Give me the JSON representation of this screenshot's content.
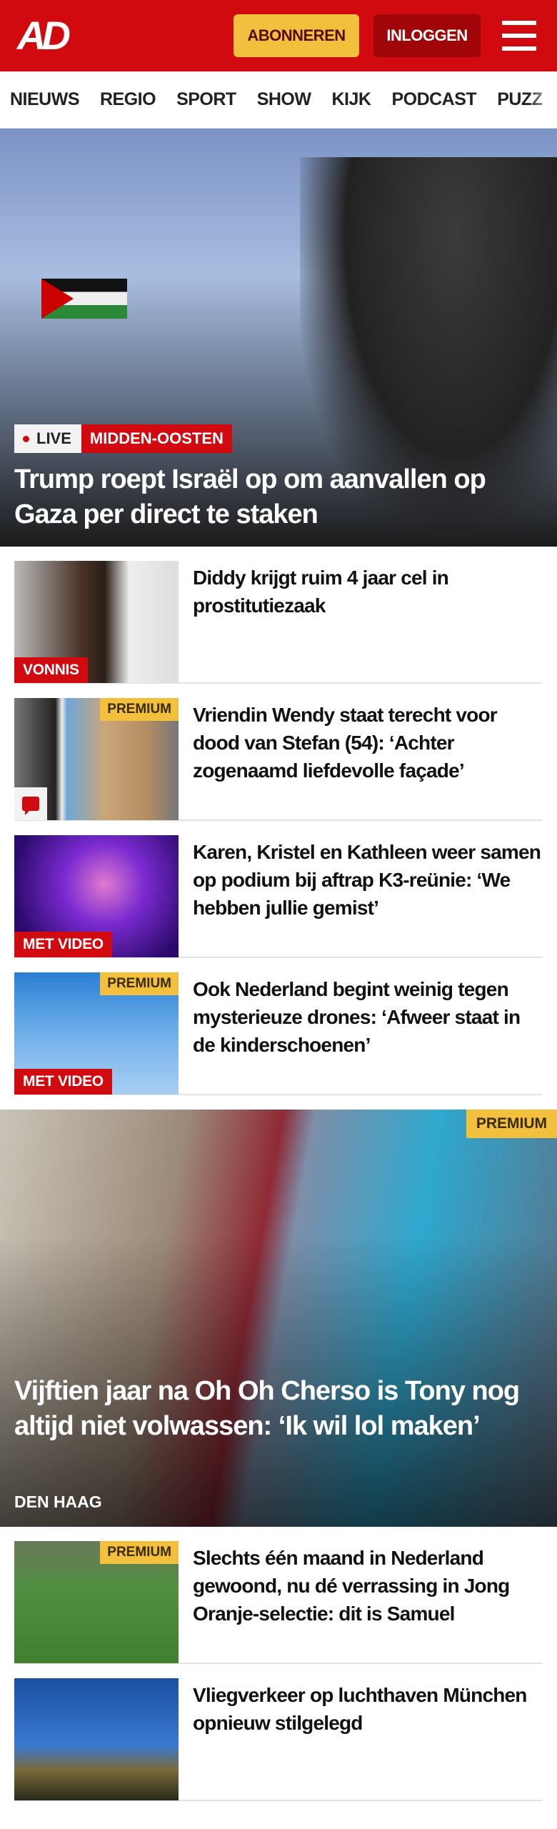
{
  "header": {
    "logo": "AD",
    "subscribe": "ABONNEREN",
    "login": "INLOGGEN"
  },
  "nav": [
    "NIEUWS",
    "REGIO",
    "SPORT",
    "SHOW",
    "KIJK",
    "PODCAST",
    "PUZZ"
  ],
  "hero": {
    "live": "LIVE",
    "category": "MIDDEN-OOSTEN",
    "title": "Trump roept Israël op om aanvallen op Gaza per direct te staken"
  },
  "articles": [
    {
      "title": "Diddy krijgt ruim 4 jaar cel in prostitutiezaak",
      "label": "VONNIS"
    },
    {
      "title": "Vriendin Wendy staat terecht voor dood van Stefan (54): ‘Achter zogenaamd liefdevolle façade’",
      "badge": "PREMIUM"
    },
    {
      "title": "Karen, Kristel en Kathleen weer samen op podium bij aftrap K3-reünie: ‘We hebben jullie gemist’",
      "label": "MET VIDEO"
    },
    {
      "title": "Ook Nederland begint weinig tegen mysterieuze drones: ‘Afweer staat in de kinderschoenen’",
      "badge": "PREMIUM",
      "label": "MET VIDEO"
    }
  ],
  "feature": {
    "badge": "PREMIUM",
    "title": "Vijftien jaar na Oh Oh Cherso is Tony nog altijd niet volwassen: ‘Ik wil lol maken’",
    "location": "DEN HAAG"
  },
  "articles2": [
    {
      "title": "Slechts één maand in Nederland gewoond, nu dé verrassing in Jong Oranje-selectie: dit is Samuel",
      "badge": "PREMIUM"
    },
    {
      "title": "Vliegverkeer op luchthaven München opnieuw stilgelegd"
    }
  ]
}
